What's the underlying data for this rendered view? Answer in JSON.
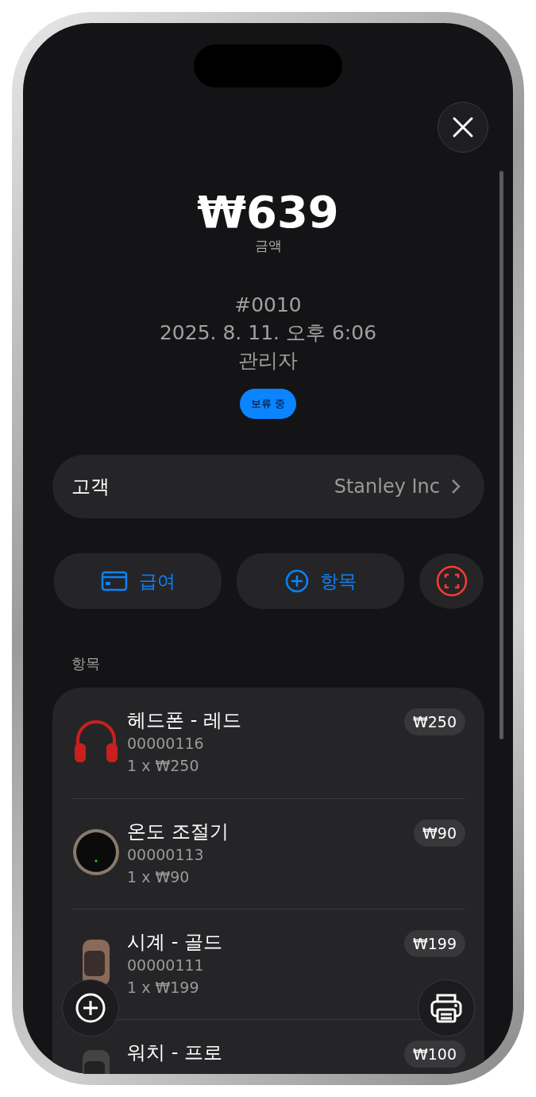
{
  "amount": {
    "value": "₩639",
    "label": "금액"
  },
  "order": {
    "number": "#0010",
    "datetime": "2025. 8. 11. 오후 6:06",
    "staff": "관리자",
    "status": "보류 중"
  },
  "customer": {
    "label": "고객",
    "value": "Stanley Inc"
  },
  "actions": [
    {
      "kind": "payment",
      "label": "급여"
    },
    {
      "kind": "add",
      "label": "항목"
    },
    {
      "kind": "scan"
    }
  ],
  "section_title": "항목",
  "items": [
    {
      "kind": "headphones",
      "name": "헤드폰 - 레드",
      "sku": "00000116",
      "qty_price": "1 x ₩250",
      "price": "₩250"
    },
    {
      "kind": "thermostat",
      "name": "온도 조절기",
      "sku": "00000113",
      "qty_price": "1 x ₩90",
      "price": "₩90"
    },
    {
      "kind": "watch",
      "name": "시계 - 골드",
      "sku": "00000111",
      "qty_price": "1 x ₩199",
      "price": "₩199"
    },
    {
      "kind": "watch-dark",
      "name": "워치 - 프로",
      "price": "₩100"
    }
  ]
}
